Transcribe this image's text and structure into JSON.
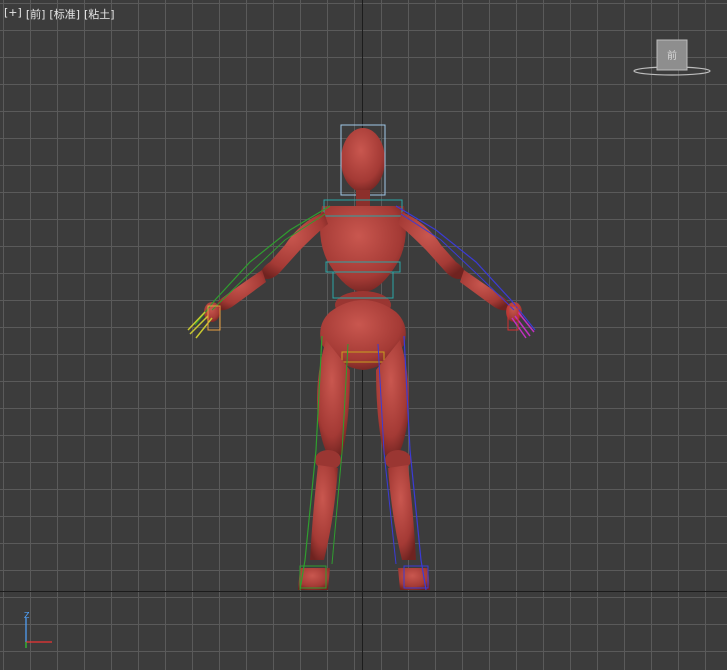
{
  "viewport": {
    "labels": [
      "[+]",
      "[前]",
      "[标准]",
      "[粘土]"
    ]
  },
  "viewcube": {
    "face_label": "前"
  },
  "gizmo": {
    "z_label": "Z"
  },
  "colors": {
    "background": "#3c3c3c",
    "grid": "#5a5a5a",
    "axis": "#1c1c1c",
    "mesh": "#a43a35",
    "bone_left": "#2f9e2f",
    "bone_right": "#3b3bd6",
    "bone_spine": "#2aa6a6",
    "hand_left": "#c8c830",
    "hand_right": "#c030c0"
  },
  "icons": {
    "viewcube": "viewcube-icon",
    "axis_gizmo": "axis-gizmo-icon"
  }
}
